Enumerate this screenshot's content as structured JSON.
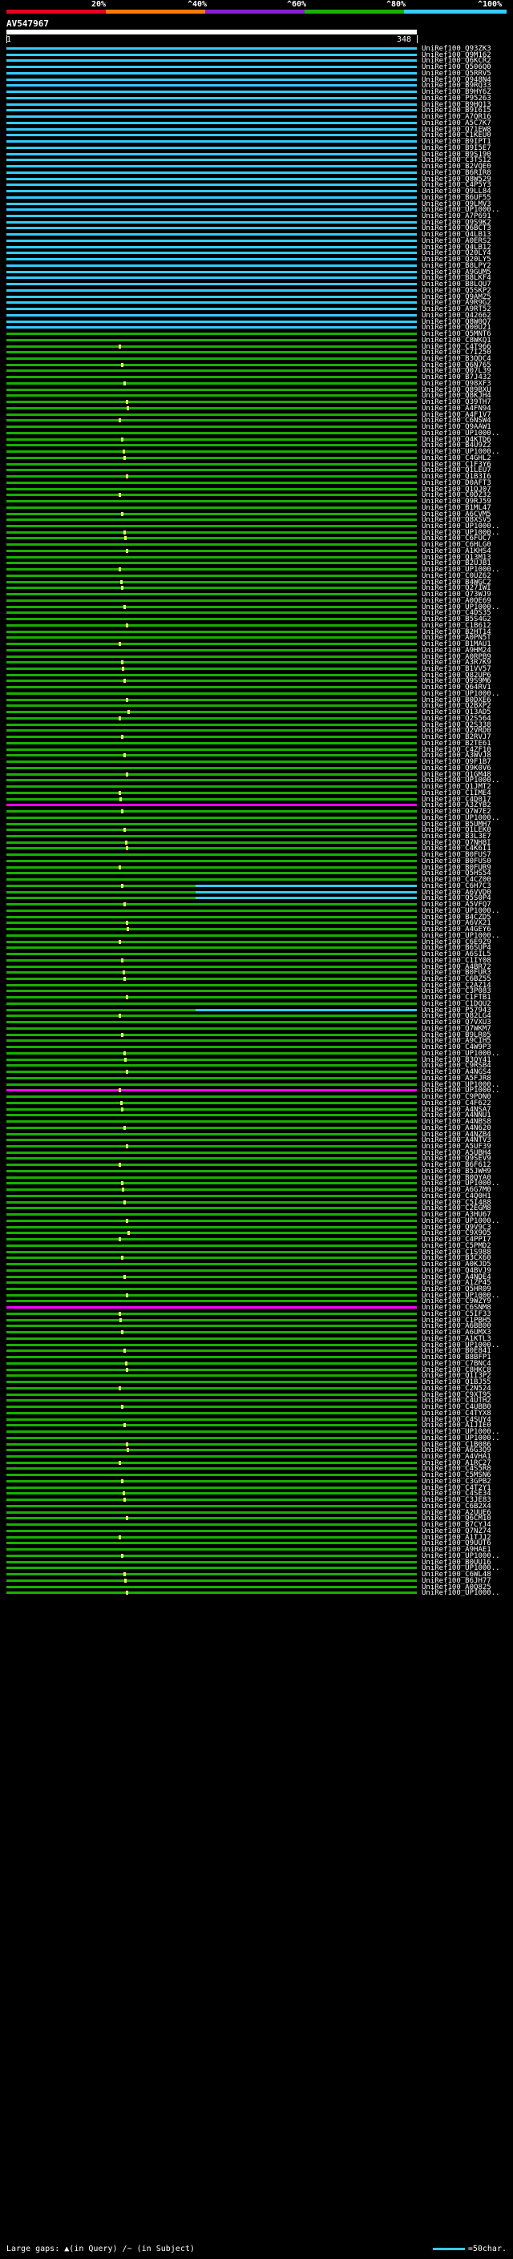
{
  "scale": {
    "labels": [
      "20%",
      "^40%",
      "^60%",
      "^80%",
      "^100%"
    ],
    "colors": [
      "#e8001e",
      "#ff7a00",
      "#8a1fd4",
      "#19b000",
      "#33ccff"
    ]
  },
  "query": {
    "title": "AV547967",
    "start_label": "1",
    "end_label": "348"
  },
  "colors": {
    "cyan": "#33ccff",
    "green": "#19b000",
    "magenta": "#ff00ff",
    "gap_marker": "#e8ff60",
    "connector": "#bbbbbb"
  },
  "hits": [
    "UniRef100_Q93ZK3",
    "UniRef100_Q9M162",
    "UniRef100_Q6KCR2",
    "UniRef100_Q506Q0",
    "UniRef100_Q5RRV5",
    "UniRef100_Q948N4",
    "UniRef100_B9RQ33",
    "UniRef100_B9HY6Z",
    "UniRef100_P95263",
    "UniRef100_B9HQ13",
    "UniRef100_B9I615",
    "UniRef100_A7QR16",
    "UniRef100_A5C7K7",
    "UniRef100_Q71EW8",
    "UniRef100_C1KEU0",
    "UniRef100_B9IPT1",
    "UniRef100_B9I5E7",
    "UniRef100_B9S190",
    "UniRef100_C3TS12",
    "UniRef100_B2VQE0",
    "UniRef100_B6RIR8",
    "UniRef100_Q8W529",
    "UniRef100_C4P5Y3",
    "UniRef100_Q9LL84",
    "UniRef100_B6UF55",
    "UniRef100_Q9LMV3",
    "UniRef100_UP1000..",
    "UniRef100_A7P691",
    "UniRef100_Q9S9K2",
    "UniRef100_Q6BCT3",
    "UniRef100_Q4LB13",
    "UniRef100_A0ERS2",
    "UniRef100_Q4LB12",
    "UniRef100_Q20LY4",
    "UniRef100_Q20LY5",
    "UniRef100_B8LPY2",
    "UniRef100_A9GUM5",
    "UniRef100_B8LKF4",
    "UniRef100_B8LQU7",
    "UniRef100_Q5SKP2",
    "UniRef100_Q9AMZ5",
    "UniRef100_A9R9G2",
    "UniRef100_A9RT52",
    "UniRef100_Q42662",
    "UniRef100_Q8W0Q7",
    "UniRef100_Q00U21",
    "UniRef100_Q5MNT6",
    "UniRef100_C8WKQ1",
    "UniRef100_C4T966",
    "UniRef100_C7I250",
    "UniRef100_B3QDC4",
    "UniRef100_Q6N765",
    "UniRef100_Q07L39",
    "UniRef100_B7J432",
    "UniRef100_Q98XF3",
    "UniRef100_Q89BXU",
    "UniRef100_Q8KJH4",
    "UniRef100_Q39TH7",
    "UniRef100_A4FN94",
    "UniRef100_A4F1V7",
    "UniRef100_C6NSW4",
    "UniRef100_Q9AAW1",
    "UniRef100_UP1000..",
    "UniRef100_Q4KTD6",
    "UniRef100_B4U9Z2",
    "UniRef100_UP1000..",
    "UniRef100_C4GHL2",
    "UniRef100_C1F3Y6",
    "UniRef100_Q1LEU7",
    "UniRef100_Q1B3I6",
    "UniRef100_D0AFT3",
    "UniRef100_Q1QJ07",
    "UniRef100_C0DZ32",
    "UniRef100_Q9RJ59",
    "UniRef100_B1ML47",
    "UniRef100_A6CVM5",
    "UniRef100_Q8XSV5",
    "UniRef100_UP1000..",
    "UniRef100_UP1000..",
    "UniRef100_C6FUC7",
    "UniRef100_C6HLG0",
    "UniRef100_A1KHS4",
    "UniRef100_Q13M13",
    "UniRef100_B2UJB1",
    "UniRef100_UP1000..",
    "UniRef100_C0UZ62",
    "UniRef100_B4WGC2",
    "UniRef100_Q27IWI",
    "UniRef100_Q73WJ9",
    "UniRef100_A0QE69",
    "UniRef100_UP1000..",
    "UniRef100_C4DS35",
    "UniRef100_B5S4G2",
    "UniRef100_C1B612",
    "UniRef100_B2HT14",
    "UniRef100_A0PN5T",
    "UniRef100_B1MAU1",
    "UniRef100_A9HM24",
    "UniRef100_A0RPB9",
    "UniRef100_A3R7K9",
    "UniRef100_B1VV57",
    "UniRef100_Q82UP6",
    "UniRef100_Q9S9M6",
    "UniRef100_Q64RV1",
    "UniRef100_UP1000..",
    "UniRef100_B0DXE6",
    "UniRef100_Q2BXP2",
    "UniRef100_Q13AD5",
    "UniRef100_Q2S564",
    "UniRef100_Q2S338",
    "UniRef100_Q2VRD0",
    "UniRef100_B2RVJ7",
    "UniRef100_B2TE61",
    "UniRef100_C4ZF10",
    "UniRef100_A3WVJ8",
    "UniRef100_Q9F1B7",
    "UniRef100_Q9K0V6",
    "UniRef100_Q1GM48",
    "UniRef100_UP1000..",
    "UniRef100_Q1JMT2",
    "UniRef100_C1IME4",
    "UniRef100_C4D017",
    "UniRef100_A3ZYB2",
    "UniRef100_Q7W7E2",
    "UniRef100_UP1000..",
    "UniRef100_B5UMH7",
    "UniRef100_Q1LEK0",
    "UniRef100_B3L3E7",
    "UniRef100_Q7NH8I",
    "UniRef100_C4K6I1",
    "UniRef100_B0FUS7",
    "UniRef100_B0FUS0",
    "UniRef100_B0FUR9",
    "UniRef100_Q5HS54",
    "UniRef100_C4CZ00",
    "UniRef100_C6H7C3",
    "UniRef100_A6VVD0",
    "UniRef100_Q5S0P4",
    "UniRef100_A5VFQ7",
    "UniRef100_UP1000..",
    "UniRef100_B4CZD5",
    "UniRef100_A6VX21",
    "UniRef100_A4GEY6",
    "UniRef100_UP1000..",
    "UniRef100_C6E9Z9",
    "UniRef100_B6SUP4",
    "UniRef100_A6SIL5",
    "UniRef100_C1IY08",
    "UniRef100_A4BR72",
    "UniRef100_B0FUR3",
    "UniRef100_C6BZ55",
    "UniRef100_C2AZ14",
    "UniRef100_C3P083",
    "UniRef100_C1FTB1",
    "UniRef100_C1DQU2",
    "UniRef100_P57943",
    "UniRef100_Q82LG4",
    "UniRef100_Q7VXU3",
    "UniRef100_Q7WKM7",
    "UniRef100_B9LR05",
    "UniRef100_A9CIH5",
    "UniRef100_C4W9P3",
    "UniRef100_UP1000..",
    "UniRef100_B3QY41",
    "UniRef100_C9RSB4",
    "UniRef100_A4NGS4",
    "UniRef100_A5FJR8",
    "UniRef100_UP1000..",
    "UniRef100_UP1000..",
    "UniRef100_C9PDN0",
    "UniRef100_C4F622",
    "UniRef100_A4NSA7",
    "UniRef100_A4NNU1",
    "UniRef100_A4NBS8",
    "UniRef100_A4N620",
    "UniRef100_A4NZB4",
    "UniRef100_A4NTV3",
    "UniRef100_A5UF39",
    "UniRef100_A5UBH4",
    "UniRef100_Q9SEV9",
    "UniRef100_B6F612",
    "UniRef100_B5JWH9",
    "UniRef100_B0QYA0",
    "UniRef100_UP1000..",
    "UniRef100_A6G7M0",
    "UniRef100_C4Q0H1",
    "UniRef100_C5I488",
    "UniRef100_C2EGM8",
    "UniRef100_A3HU67",
    "UniRef100_UP1000..",
    "UniRef100_Q9V9C3",
    "UniRef100_C9X9O5",
    "UniRef100_C4PPI7",
    "UniRef100_C5PMD2",
    "UniRef100_C1S988",
    "UniRef100_B3CX60",
    "UniRef100_A0KJD5",
    "UniRef100_Q4BVJ9",
    "UniRef100_A4NDE4",
    "UniRef100_A1ZP45",
    "UniRef100_Q5HR09",
    "UniRef100_UP1000..",
    "UniRef100_C9WZY9",
    "UniRef100_C6SNM8",
    "UniRef100_C5IF33",
    "UniRef100_C1PBH5",
    "UniRef100_A6BB00",
    "UniRef100_A6UMX3",
    "UniRef100_A1KTL3",
    "UniRef100_UP1000..",
    "UniRef100_B0E841",
    "UniRef100_B8BFP1",
    "UniRef100_C7BNC4",
    "UniRef100_C8HKC8",
    "UniRef100_Q1I3P2",
    "UniRef100_Q1BJ55",
    "UniRef100_C2N524",
    "UniRef100_C9XT95",
    "UniRef100_C4UTH2",
    "UniRef100_C4UBB0",
    "UniRef100_C4TYX8",
    "UniRef100_C4SUY4",
    "UniRef100_A1JIE0",
    "UniRef100_UP1000..",
    "UniRef100_UP1000..",
    "UniRef100_C1B086",
    "UniRef100_A6G3Q9",
    "UniRef100_A4VHA1",
    "UniRef100_A1RC27",
    "UniRef100_C4S5R8",
    "UniRef100_C5MSN6",
    "UniRef100_C3GPB2",
    "UniRef100_C4T2Y1",
    "UniRef100_C4SE34",
    "UniRef100_C3JE83",
    "UniRef100_C6B2X4",
    "UniRef100_A2UUE6",
    "UniRef100_Q6CM10",
    "UniRef100_B7CYJ4",
    "UniRef100_Q7NZ74",
    "UniRef100_A1TJJ2",
    "UniRef100_Q9UUT6",
    "UniRef100_A9HAE1",
    "UniRef100_UP1000..",
    "UniRef100_B0UU16",
    "UniRef100_UP1000..",
    "UniRef100_C6WL48",
    "UniRef100_B6JH77",
    "UniRef100_A0Q825",
    "UniRef100_UP1000.."
  ],
  "magenta_hits": [
    122,
    168,
    203,
    279
  ],
  "split_hits": [
    {
      "index": 135,
      "right_color": "cyan",
      "left_color": "green",
      "split_at": 0.46
    },
    {
      "index": 136,
      "right_color": "cyan",
      "left_color": "green",
      "split_at": 0.46
    },
    {
      "index": 137,
      "right_color": "cyan",
      "left_color": "green",
      "split_at": 0.46
    },
    {
      "index": 155,
      "right_color": "cyan",
      "left_color": "green",
      "split_at": 0.46
    }
  ],
  "footer": {
    "large_gaps_label": "Large gaps:",
    "in_query": "(in Query)",
    "in_subject": "(in Subject)",
    "legend_label": "=50char."
  }
}
